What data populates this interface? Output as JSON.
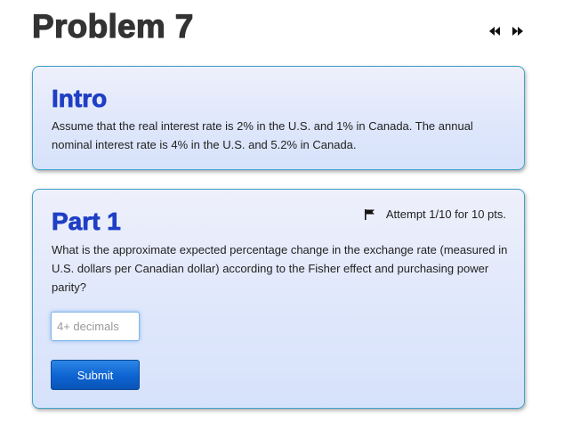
{
  "problem": {
    "title": "Problem 7"
  },
  "nav": {
    "prev_icon": "rewind-icon",
    "next_icon": "fast-forward-icon"
  },
  "intro": {
    "heading": "Intro",
    "text": "Assume that the real interest rate is 2% in the U.S. and 1% in Canada. The annual nominal interest rate is 4% in the U.S. and 5.2% in Canada."
  },
  "part1": {
    "heading": "Part 1",
    "attempt_icon": "flag-icon",
    "attempt_text": "Attempt 1/10 for 10 pts.",
    "question": "What is the approximate expected percentage change in the exchange rate (measured in U.S. dollars per Canadian dollar) according to the Fisher effect and purchasing power parity?",
    "input_placeholder": "4+ decimals",
    "input_value": "",
    "submit_label": "Submit"
  },
  "colors": {
    "title_text": "#333333",
    "heading_blue": "#1f3fc4",
    "card_border": "#3fa2c9",
    "card_bg": "#dfe7fb",
    "button_blue": "#0d63d1"
  }
}
